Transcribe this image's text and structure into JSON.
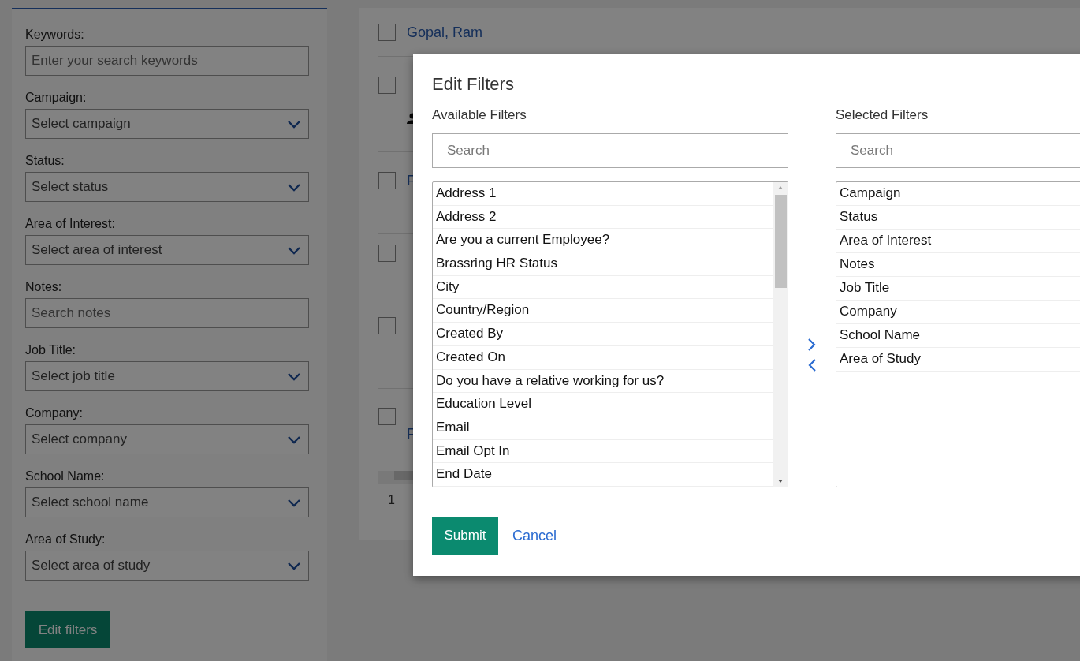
{
  "sidebar": {
    "fields": [
      {
        "label": "Keywords:",
        "placeholder": "Enter your search keywords",
        "kind": "text"
      },
      {
        "label": "Campaign:",
        "placeholder": "Select campaign",
        "kind": "select"
      },
      {
        "label": "Status:",
        "placeholder": "Select status",
        "kind": "select"
      },
      {
        "label": "Area of Interest:",
        "placeholder": "Select area of interest",
        "kind": "select"
      },
      {
        "label": "Notes:",
        "placeholder": "Search notes",
        "kind": "text"
      },
      {
        "label": "Job Title:",
        "placeholder": "Select job title",
        "kind": "select"
      },
      {
        "label": "Company:",
        "placeholder": "Select company",
        "kind": "select"
      },
      {
        "label": "School Name:",
        "placeholder": "Select school name",
        "kind": "select"
      },
      {
        "label": "Area of Study:",
        "placeholder": "Select area of study",
        "kind": "select"
      }
    ],
    "button": "Edit filters"
  },
  "results": {
    "rows": [
      {
        "lines": [
          "Gopal, Ram"
        ],
        "checked": false,
        "kind": "plain"
      },
      {
        "checked": false,
        "kind": "person"
      },
      {
        "lines": [
          "F"
        ],
        "checked": false,
        "kind": "plain"
      },
      {
        "checked": false,
        "kind": "plain"
      },
      {
        "checked": false,
        "kind": "plain"
      },
      {
        "lines": [
          "F"
        ],
        "checked": false,
        "kind": "plain"
      }
    ],
    "pagination": "1"
  },
  "dialog": {
    "title": "Edit Filters",
    "available": {
      "label": "Available Filters",
      "search_placeholder": "Search",
      "items": [
        {
          "label": "Address 1",
          "selected": false
        },
        {
          "label": "Address 2",
          "selected": false
        },
        {
          "label": "Are you a current Employee?",
          "selected": false
        },
        {
          "label": "Brassring HR Status",
          "selected": false
        },
        {
          "label": "City",
          "selected": false
        },
        {
          "label": "Country/Region",
          "selected": false
        },
        {
          "label": "Created By",
          "selected": false
        },
        {
          "label": "Created On",
          "selected": false
        },
        {
          "label": "Do you have a relative working for us?",
          "selected": false
        },
        {
          "label": "Education Level",
          "selected": false
        },
        {
          "label": "Email",
          "selected": false
        },
        {
          "label": "Email Opt In",
          "selected": false
        },
        {
          "label": "End Date",
          "selected": false
        }
      ]
    },
    "selected_filters": {
      "label": "Selected Filters",
      "search_placeholder": "Search",
      "items": [
        {
          "label": "Campaign",
          "selected": false
        },
        {
          "label": "Status",
          "selected": false
        },
        {
          "label": "Area of Interest",
          "selected": false
        },
        {
          "label": "Notes",
          "selected": false
        },
        {
          "label": "Job Title",
          "selected": false
        },
        {
          "label": "Company",
          "selected": false
        },
        {
          "label": "School Name",
          "selected": false
        },
        {
          "label": "Area of Study",
          "selected": false
        }
      ]
    },
    "submit": "Submit",
    "cancel": "Cancel"
  }
}
